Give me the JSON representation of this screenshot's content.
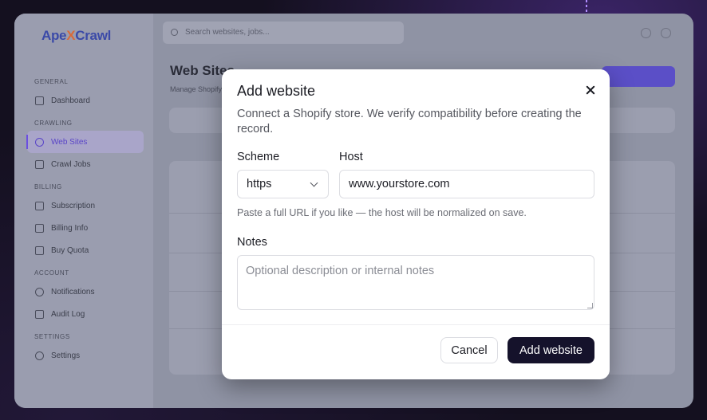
{
  "app": {
    "logo_prefix": "Ape",
    "logo_x": "X",
    "logo_suffix": "Crawl",
    "search_placeholder": "Search websites, jobs..."
  },
  "sidebar": {
    "sections": [
      {
        "title": "GENERAL",
        "items": [
          {
            "label": "Dashboard",
            "icon": "grid-icon"
          }
        ]
      },
      {
        "title": "CRAWLING",
        "items": [
          {
            "label": "Web Sites",
            "icon": "globe-icon",
            "active": true
          },
          {
            "label": "Crawl Jobs",
            "icon": "briefcase-icon"
          }
        ]
      },
      {
        "title": "BILLING",
        "items": [
          {
            "label": "Subscription",
            "icon": "card-icon"
          },
          {
            "label": "Billing Info",
            "icon": "document-icon"
          },
          {
            "label": "Buy Quota",
            "icon": "bag-icon"
          }
        ]
      },
      {
        "title": "ACCOUNT",
        "items": [
          {
            "label": "Notifications",
            "icon": "bell-icon"
          },
          {
            "label": "Audit Log",
            "icon": "log-icon"
          }
        ]
      },
      {
        "title": "SETTINGS",
        "items": [
          {
            "label": "Settings",
            "icon": "gear-icon"
          }
        ]
      }
    ]
  },
  "page": {
    "title": "Web Sites",
    "subtitle": "Manage Shopify"
  },
  "modal": {
    "title": "Add website",
    "description": "Connect a Shopify store. We verify compatibility before creating the record.",
    "scheme_label": "Scheme",
    "scheme_value": "https",
    "host_label": "Host",
    "host_value": "www.yourstore.com",
    "hint": "Paste a full URL if you like — the host will be normalized on save.",
    "notes_label": "Notes",
    "notes_placeholder": "Optional description or internal notes",
    "cancel_label": "Cancel",
    "submit_label": "Add website"
  }
}
